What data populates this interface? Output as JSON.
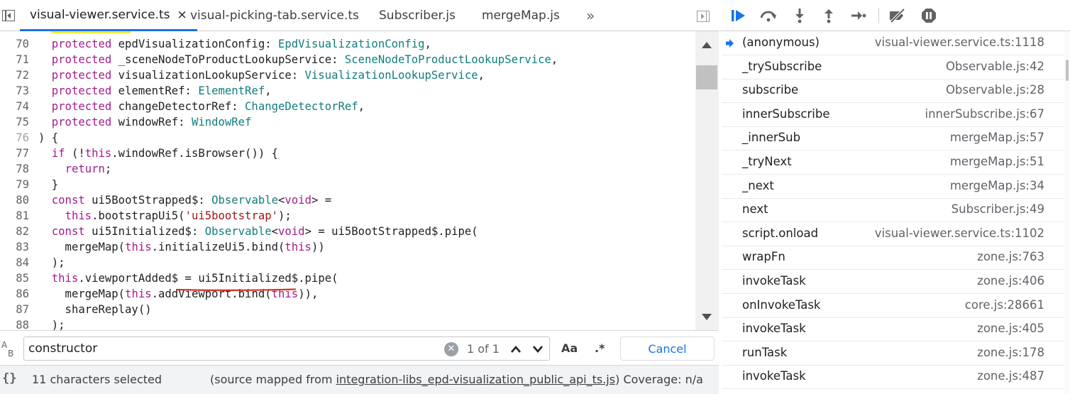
{
  "tabs": [
    {
      "label": "visual-viewer.service.ts",
      "active": true,
      "close": "×"
    },
    {
      "label": "visual-picking-tab.service.ts",
      "active": false
    },
    {
      "label": "Subscriber.js",
      "active": false
    },
    {
      "label": "mergeMap.js",
      "active": false
    }
  ],
  "more_tabs_glyph": "»",
  "editor": {
    "lines": [
      {
        "n": "70",
        "tokens": [
          {
            "t": "  "
          },
          {
            "t": "protected",
            "c": "kw"
          },
          {
            "t": " epdVisualizationConfig: "
          },
          {
            "t": "EpdVisualizationConfig",
            "c": "ty"
          },
          {
            "t": ","
          }
        ]
      },
      {
        "n": "71",
        "tokens": [
          {
            "t": "  "
          },
          {
            "t": "protected",
            "c": "kw"
          },
          {
            "t": " _sceneNodeToProductLookupService: "
          },
          {
            "t": "SceneNodeToProductLookupService",
            "c": "ty"
          },
          {
            "t": ","
          }
        ]
      },
      {
        "n": "72",
        "tokens": [
          {
            "t": "  "
          },
          {
            "t": "protected",
            "c": "kw"
          },
          {
            "t": " visualizationLookupService: "
          },
          {
            "t": "VisualizationLookupService",
            "c": "ty"
          },
          {
            "t": ","
          }
        ]
      },
      {
        "n": "73",
        "tokens": [
          {
            "t": "  "
          },
          {
            "t": "protected",
            "c": "kw"
          },
          {
            "t": " elementRef: "
          },
          {
            "t": "ElementRef",
            "c": "ty"
          },
          {
            "t": ","
          }
        ]
      },
      {
        "n": "74",
        "tokens": [
          {
            "t": "  "
          },
          {
            "t": "protected",
            "c": "kw"
          },
          {
            "t": " changeDetectorRef: "
          },
          {
            "t": "ChangeDetectorRef",
            "c": "ty"
          },
          {
            "t": ","
          }
        ]
      },
      {
        "n": "75",
        "tokens": [
          {
            "t": "  "
          },
          {
            "t": "protected",
            "c": "kw"
          },
          {
            "t": " windowRef: "
          },
          {
            "t": "WindowRef",
            "c": "ty"
          }
        ]
      },
      {
        "n": "76",
        "dim": true,
        "tokens": [
          {
            "t": ") {"
          }
        ]
      },
      {
        "n": "77",
        "tokens": [
          {
            "t": "  "
          },
          {
            "t": "if",
            "c": "kw"
          },
          {
            "t": " (!"
          },
          {
            "t": "this",
            "c": "kw"
          },
          {
            "t": ".windowRef.isBrowser()) {"
          }
        ]
      },
      {
        "n": "78",
        "tokens": [
          {
            "t": "    "
          },
          {
            "t": "return",
            "c": "kw"
          },
          {
            "t": ";"
          }
        ]
      },
      {
        "n": "79",
        "tokens": [
          {
            "t": "  }"
          }
        ]
      },
      {
        "n": "80",
        "tokens": [
          {
            "t": "  "
          },
          {
            "t": "const",
            "c": "kw"
          },
          {
            "t": " ui5BootStrapped$: "
          },
          {
            "t": "Observable",
            "c": "ty"
          },
          {
            "t": "<"
          },
          {
            "t": "void",
            "c": "kw"
          },
          {
            "t": "> ="
          }
        ]
      },
      {
        "n": "81",
        "tokens": [
          {
            "t": "    "
          },
          {
            "t": "this",
            "c": "kw"
          },
          {
            "t": ".bootstrapUi5("
          },
          {
            "t": "'ui5bootstrap'",
            "c": "st"
          },
          {
            "t": ");"
          }
        ]
      },
      {
        "n": "82",
        "tokens": [
          {
            "t": "  "
          },
          {
            "t": "const",
            "c": "kw"
          },
          {
            "t": " ui5Initialized$: "
          },
          {
            "t": "Observable",
            "c": "ty"
          },
          {
            "t": "<"
          },
          {
            "t": "void",
            "c": "kw"
          },
          {
            "t": "> = ui5BootStrapped$.pipe("
          }
        ]
      },
      {
        "n": "83",
        "tokens": [
          {
            "t": "    mergeMap("
          },
          {
            "t": "this",
            "c": "kw"
          },
          {
            "t": ".initializeUi5.bind("
          },
          {
            "t": "this",
            "c": "kw"
          },
          {
            "t": "))"
          }
        ]
      },
      {
        "n": "84",
        "tokens": [
          {
            "t": "  );"
          }
        ]
      },
      {
        "n": "85",
        "tokens": [
          {
            "t": "  "
          },
          {
            "t": "this",
            "c": "kw"
          },
          {
            "t": ".viewportAdded$ = ui5Initialized$.pipe("
          }
        ]
      },
      {
        "n": "86",
        "tokens": [
          {
            "t": "    mergeMap("
          },
          {
            "t": "this",
            "c": "kw"
          },
          {
            "t": ".addViewport.bind("
          },
          {
            "t": "this",
            "c": "kw"
          },
          {
            "t": ")),"
          }
        ]
      },
      {
        "n": "87",
        "tokens": [
          {
            "t": "    shareReplay()"
          }
        ]
      },
      {
        "n": "88",
        "tokens": [
          {
            "t": "  );"
          }
        ]
      }
    ]
  },
  "search": {
    "replace_toggle": "A\nB",
    "value": "constructor",
    "clear_glyph": "✕",
    "match_count": "1 of 1",
    "case_label": "Aa",
    "regex_label": ".*",
    "cancel_label": "Cancel"
  },
  "status": {
    "pretty_print": "{}",
    "selected": "11 characters selected",
    "mapped_prefix": "(source mapped from ",
    "mapped_file": "integration-libs_epd-visualization_public_api_ts.js",
    "mapped_suffix": ")",
    "coverage": "Coverage: n/a"
  },
  "call_stack": [
    {
      "fn": "(anonymous)",
      "loc": "visual-viewer.service.ts:1118",
      "current": true
    },
    {
      "fn": "_trySubscribe",
      "loc": "Observable.js:42"
    },
    {
      "fn": "subscribe",
      "loc": "Observable.js:28"
    },
    {
      "fn": "innerSubscribe",
      "loc": "innerSubscribe.js:67"
    },
    {
      "fn": "_innerSub",
      "loc": "mergeMap.js:57"
    },
    {
      "fn": "_tryNext",
      "loc": "mergeMap.js:51"
    },
    {
      "fn": "_next",
      "loc": "mergeMap.js:34"
    },
    {
      "fn": "next",
      "loc": "Subscriber.js:49"
    },
    {
      "fn": "script.onload",
      "loc": "visual-viewer.service.ts:1102"
    },
    {
      "fn": "wrapFn",
      "loc": "zone.js:763"
    },
    {
      "fn": "invokeTask",
      "loc": "zone.js:406"
    },
    {
      "fn": "onInvokeTask",
      "loc": "core.js:28661"
    },
    {
      "fn": "invokeTask",
      "loc": "zone.js:405"
    },
    {
      "fn": "runTask",
      "loc": "zone.js:178"
    },
    {
      "fn": "invokeTask",
      "loc": "zone.js:487"
    }
  ],
  "colors": {
    "accent": "#1a73e8",
    "keyword": "#a21c8d",
    "type": "#127d7d",
    "string": "#a31515",
    "search_highlight": "#f3ea35",
    "underline_annotation": "#d93025"
  }
}
